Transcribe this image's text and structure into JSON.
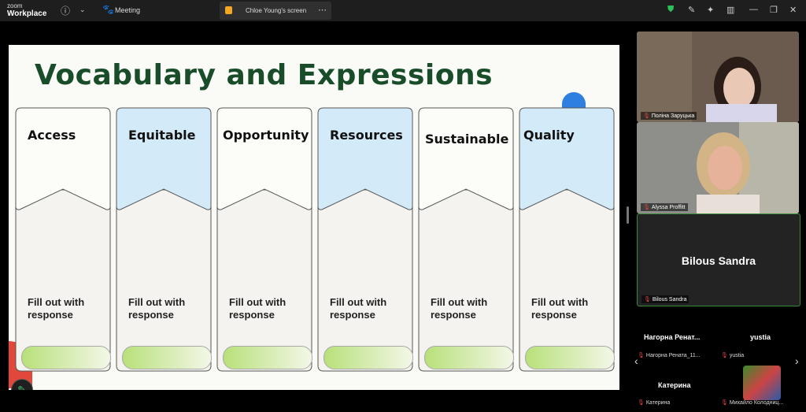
{
  "app": {
    "logo_line1": "zoom",
    "logo_line2": "Workplace"
  },
  "toolbar": {
    "meeting_label": "Meeting",
    "screen_share_label": "Chloe Young's screen"
  },
  "slide": {
    "title": "Vocabulary and Expressions",
    "columns": [
      {
        "term": "Access",
        "placeholder": "Fill out with response"
      },
      {
        "term": "Equitable",
        "placeholder": "Fill out with response"
      },
      {
        "term": "Opportunity",
        "placeholder": "Fill out with response"
      },
      {
        "term": "Resources",
        "placeholder": "Fill out with response"
      },
      {
        "term": "Sustainable",
        "placeholder": "Fill out with response"
      },
      {
        "term": "Quality",
        "placeholder": "Fill out with response"
      }
    ]
  },
  "participants": {
    "video": [
      {
        "name": "Поліна Заруцька"
      },
      {
        "name": "Alyssa Proffitt"
      }
    ],
    "active": {
      "display": "Bilous Sandra",
      "label": "Bilous Sandra"
    },
    "grid": [
      {
        "display": "Нагорна  Ренат...",
        "label": "Нагорна Рената_11..."
      },
      {
        "display": "yustia",
        "label": "yustia"
      },
      {
        "display": "Катерина",
        "label": "Катерина"
      },
      {
        "display": "",
        "label": "Михайло Колодниц..."
      }
    ]
  },
  "colors": {
    "title": "#194d2a",
    "blue_card": "#d3eaf8",
    "pill_green": "#b8e07a",
    "accent_green": "#3fbf6a"
  }
}
